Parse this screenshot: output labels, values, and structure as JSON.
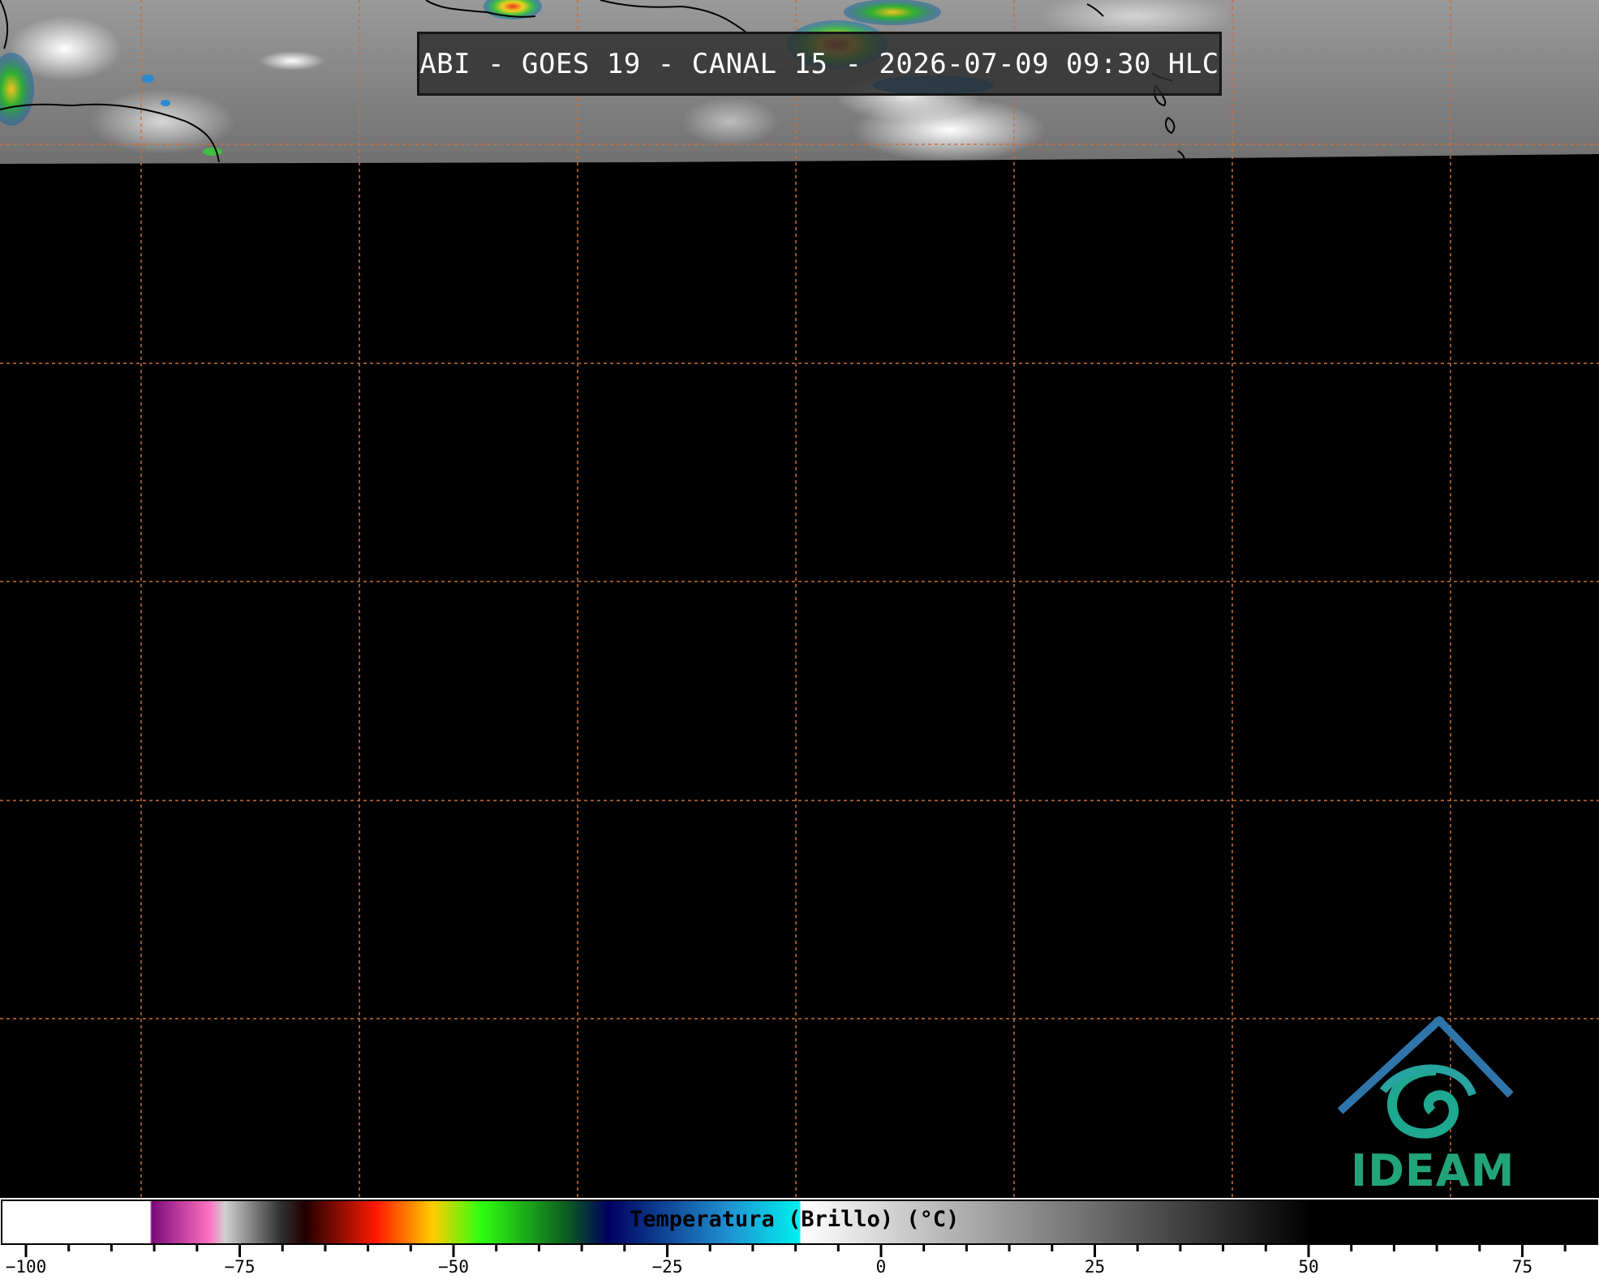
{
  "title": "ABI - GOES 19 - CANAL 15 - 2026-07-09 09:30 HLC",
  "logo": {
    "text": "IDEAM",
    "color": "#22a47a"
  },
  "colorbar": {
    "label": "Temperatura (Brillo) (°C)",
    "ticks": [
      {
        "value": -100,
        "label": "−100"
      },
      {
        "value": -75,
        "label": "−75"
      },
      {
        "value": -50,
        "label": "−50"
      },
      {
        "value": -25,
        "label": "−25"
      },
      {
        "value": 0,
        "label": "0"
      },
      {
        "value": 25,
        "label": "25"
      },
      {
        "value": 50,
        "label": "50"
      },
      {
        "value": 75,
        "label": "75"
      }
    ],
    "range": [
      -103,
      84
    ]
  },
  "map": {
    "gridline_color": "#c8703a",
    "coverage": "satellite imagery only in top band; remainder black (no data)"
  }
}
